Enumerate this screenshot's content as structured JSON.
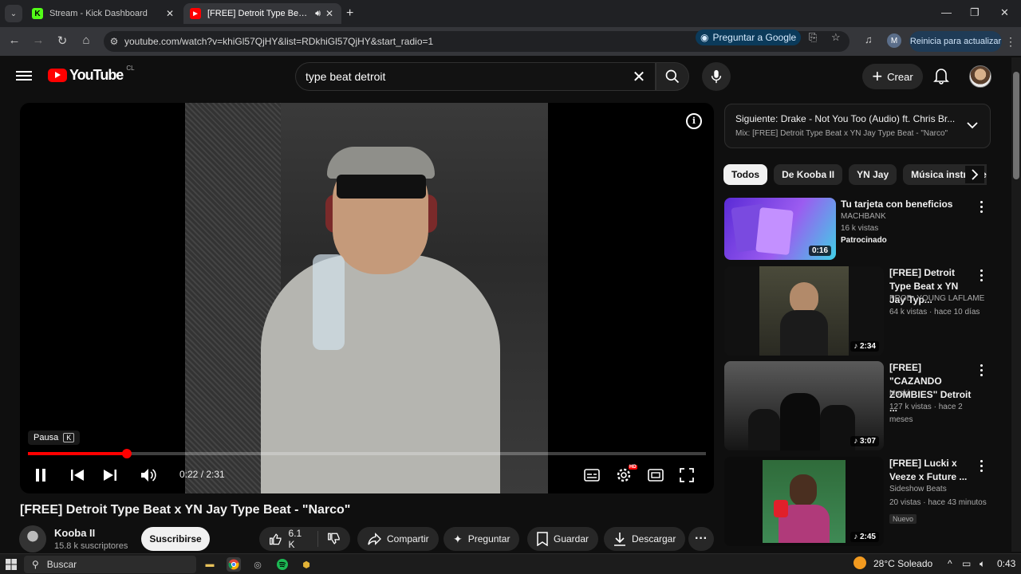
{
  "browser": {
    "tabs": [
      {
        "title": "Stream - Kick Dashboard",
        "favicon": "K"
      },
      {
        "title": "[FREE] Detroit Type Beat x YN Jay Type Beat - \"Narco\"",
        "favicon": "▶"
      }
    ],
    "url": "youtube.com/watch?v=khiGl57QjHY&list=RDkhiGl57QjHY&start_radio=1",
    "ask_google": "Preguntar a Google",
    "profile_initial": "M",
    "update_button": "Reinicia para actualizar"
  },
  "youtube": {
    "logo_text": "YouTube",
    "country_code": "CL",
    "search_query": "type beat detroit",
    "create_label": "Crear"
  },
  "player": {
    "tooltip_label": "Pausa",
    "tooltip_key": "K",
    "time_display": "0:22 / 2:31",
    "progress_fraction": 0.1457,
    "hd_badge": "HD"
  },
  "video": {
    "title": "[FREE] Detroit Type Beat x YN Jay Type Beat - \"Narco\"",
    "channel": "Kooba II",
    "subscribers": "15.8 k suscriptores",
    "subscribe_label": "Suscribirse",
    "likes": "6.1 K",
    "share_label": "Compartir",
    "ask_label": "Preguntar",
    "save_label": "Guardar",
    "download_label": "Descargar"
  },
  "up_next": {
    "line1_prefix": "Siguiente:",
    "line1_title": "Drake - Not You Too (Audio) ft. Chris Br...",
    "line2": "Mix: [FREE] Detroit Type Beat x YN Jay Type Beat - \"Narco\""
  },
  "chips": [
    "Todos",
    "De Kooba II",
    "YN Jay",
    "Música instrumental"
  ],
  "recommendations": [
    {
      "title": "Tu tarjeta con beneficios",
      "channel": "MACHBANK",
      "meta": "16 k vistas",
      "extra": "Patrocinado",
      "duration": "0:16"
    },
    {
      "title": "[FREE] Detroit Type Beat x YN Jay Typ...",
      "channel": "PROD. YOUNG LAFLAME",
      "meta": "64 k vistas · hace 10 días",
      "duration": "♪ 2:34"
    },
    {
      "title": "[FREE] \"CAZANDO ZOMBIES\" Detroit ...",
      "channel": "Nuski",
      "meta": "127 k vistas · hace 2 meses",
      "duration": "♪ 3:07"
    },
    {
      "title": "[FREE] Lucki x Veeze x Future ...",
      "channel": "Sideshow Beats",
      "meta": "20 vistas · hace 43 minutos",
      "badge": "Nuevo",
      "duration": "♪ 2:45"
    }
  ],
  "taskbar": {
    "search_placeholder": "Buscar",
    "weather": "28°C  Soleado",
    "clock": "0:43"
  },
  "colors": {
    "accent": "#ff0000",
    "background": "#0f0f0f"
  }
}
